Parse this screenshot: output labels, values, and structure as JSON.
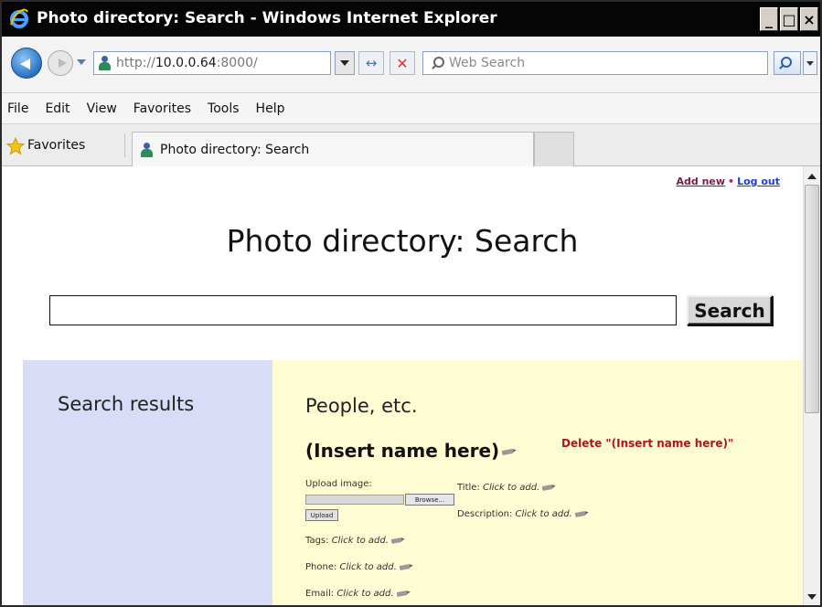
{
  "window": {
    "title": "Photo directory: Search - Windows Internet Explorer",
    "controls": {
      "minimize": "_",
      "maximize": "□",
      "close": "×"
    }
  },
  "addressbar": {
    "url_prefix": "http://",
    "url_host": "10.0.0.64",
    "url_suffix": ":8000/",
    "search_placeholder": "Web Search",
    "refresh_glyph": "↔",
    "stop_glyph": "✕"
  },
  "menu": [
    "File",
    "Edit",
    "View",
    "Favorites",
    "Tools",
    "Help"
  ],
  "favorites": {
    "label": "Favorites",
    "tab_title": "Photo directory: Search"
  },
  "page": {
    "top_links": {
      "add_new": "Add new",
      "separator": "•",
      "log_out": "Log out"
    },
    "title": "Photo directory: Search",
    "search_value": "",
    "search_button": "Search",
    "left_heading": "Search results",
    "right_heading": "People, etc.",
    "entry": {
      "name": "(Insert name here)",
      "delete_link": "Delete \"(Insert name here)\"",
      "upload_label": "Upload image:",
      "browse_button": "Browse...",
      "upload_button": "Upload",
      "fields": [
        {
          "label": "Title:",
          "value": "Click to add."
        },
        {
          "label": "Description:",
          "value": "Click to add."
        },
        {
          "label": "Tags:",
          "value": "Click to add."
        },
        {
          "label": "Phone:",
          "value": "Click to add."
        },
        {
          "label": "Email:",
          "value": "Click to add."
        }
      ]
    }
  },
  "icons": [
    "ie-logo-icon",
    "back-icon",
    "forward-icon",
    "page-person-icon",
    "search-icon",
    "favorites-star-icon",
    "pencil-icon"
  ]
}
